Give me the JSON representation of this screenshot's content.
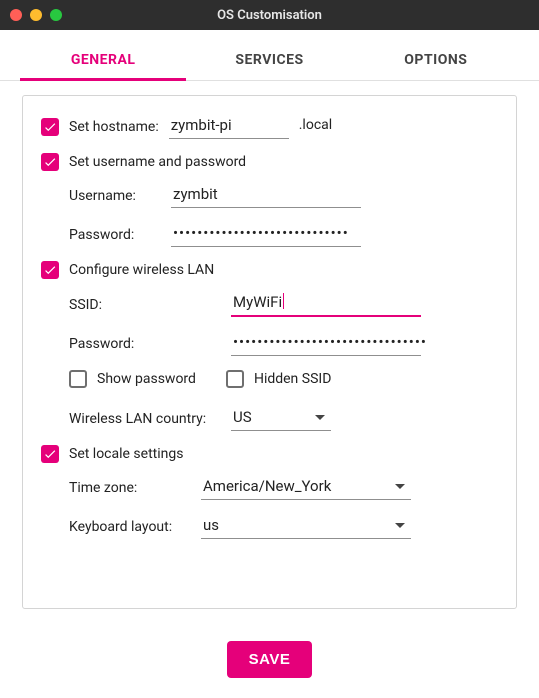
{
  "window": {
    "title": "OS Customisation"
  },
  "tabs": {
    "general": "GENERAL",
    "services": "SERVICES",
    "options": "OPTIONS"
  },
  "hostname": {
    "checkbox_label": "Set hostname:",
    "value": "zymbit-pi",
    "suffix": ".local"
  },
  "userpass": {
    "checkbox_label": "Set username and password",
    "username_label": "Username:",
    "username_value": "zymbit",
    "password_label": "Password:",
    "password_value": "•••••••••••••••••••••••••••••"
  },
  "wifi": {
    "checkbox_label": "Configure wireless LAN",
    "ssid_label": "SSID:",
    "ssid_value": "MyWiFi",
    "password_label": "Password:",
    "password_value": "••••••••••••••••••••••••••••••••",
    "show_password_label": "Show password",
    "hidden_ssid_label": "Hidden SSID",
    "country_label": "Wireless LAN country:",
    "country_value": "US"
  },
  "locale": {
    "checkbox_label": "Set locale settings",
    "timezone_label": "Time zone:",
    "timezone_value": "America/New_York",
    "keyboard_label": "Keyboard layout:",
    "keyboard_value": "us"
  },
  "save_button": "SAVE",
  "colors": {
    "accent": "#e5007a"
  }
}
